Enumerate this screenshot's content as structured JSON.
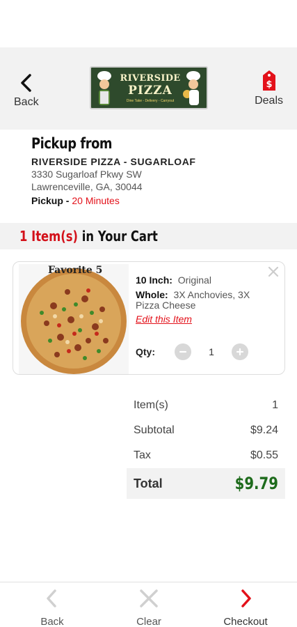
{
  "header": {
    "back_label": "Back",
    "deals_label": "Deals",
    "logo": {
      "line1": "RIVERSIDE",
      "line2": "PIZZA",
      "tagline": "Dine Take - Delivery - Carryout"
    }
  },
  "pickup": {
    "title": "Pickup from",
    "store": "RIVERSIDE PIZZA - SUGARLOAF",
    "address1": "3330 Sugarloaf Pkwy SW",
    "address2": "Lawrenceville, GA, 30044",
    "time_label": "Pickup - ",
    "time_value": "20 Minutes"
  },
  "cart": {
    "count_text": "1 Item(s)",
    "title_suffix": " in Your Cart",
    "items": [
      {
        "name": "Favorite 5",
        "size_label": "10 Inch:",
        "size_value": "Original",
        "whole_label": "Whole:",
        "whole_value": "3X Anchovies, 3X Pizza Cheese",
        "edit_label": "Edit this Item",
        "qty_label": "Qty:",
        "qty_value": "1"
      }
    ]
  },
  "totals": {
    "items_label": "Item(s)",
    "items_value": "1",
    "subtotal_label": "Subtotal",
    "subtotal_value": "$9.24",
    "tax_label": "Tax",
    "tax_value": "$0.55",
    "total_label": "Total",
    "total_value": "$9.79"
  },
  "footer": {
    "back_label": "Back",
    "clear_label": "Clear",
    "checkout_label": "Checkout"
  },
  "colors": {
    "accent_red": "#e3111a",
    "total_green": "#1e6b1c",
    "logo_green": "#2e4a2c"
  }
}
